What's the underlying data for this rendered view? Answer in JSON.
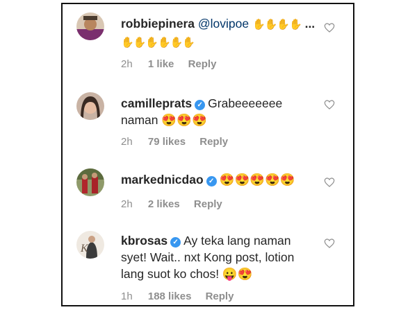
{
  "comments": [
    {
      "username": "robbiepinera",
      "verified": false,
      "mention": "@lovipoe",
      "text_line1": "✋✋✋✋",
      "more": "...",
      "text_line2": "✋✋✋✋✋✋",
      "time": "2h",
      "likes": "1 like",
      "reply": "Reply"
    },
    {
      "username": "camilleprats",
      "verified": true,
      "text_line1": "Grabeeeeeee",
      "text_line2": "naman 😍😍😍",
      "time": "2h",
      "likes": "79 likes",
      "reply": "Reply"
    },
    {
      "username": "markednicdao",
      "verified": true,
      "text_line1": "😍😍😍😍😍",
      "time": "2h",
      "likes": "2 likes",
      "reply": "Reply"
    },
    {
      "username": "kbrosas",
      "verified": true,
      "text_line1": "Ay teka lang naman",
      "text_line2": "syet! Wait.. nxt Kong post, lotion",
      "text_line3": "lang suot ko chos! 😛😍",
      "time": "1h",
      "likes": "188 likes",
      "reply": "Reply"
    }
  ],
  "icons": {
    "verified": "verified-badge-icon",
    "like": "heart-outline-icon"
  },
  "colors": {
    "text": "#262626",
    "meta": "#8e8e8e",
    "verified": "#3897f0"
  }
}
